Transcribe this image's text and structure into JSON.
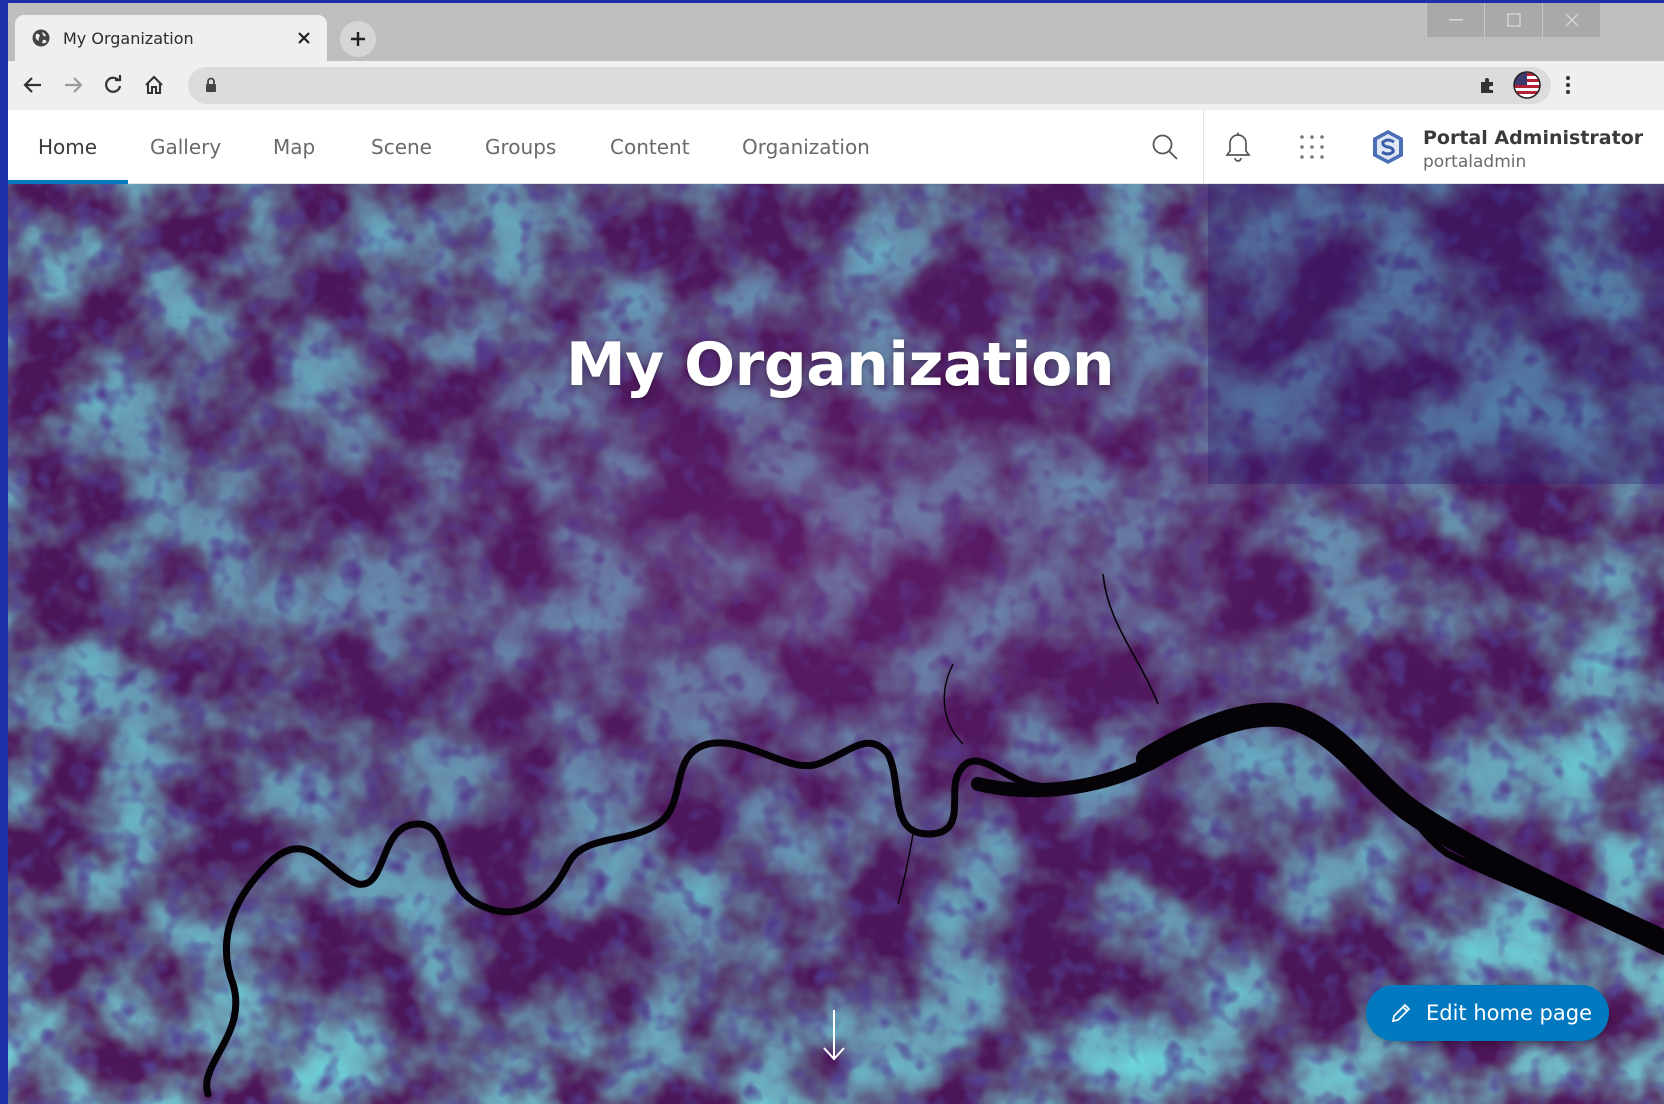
{
  "browser": {
    "tab_title": "My Organization",
    "url": "",
    "icons": {
      "favicon": "globe-icon",
      "close": "close-icon",
      "new_tab": "plus-icon",
      "back": "back-arrow-icon",
      "forward": "forward-arrow-icon",
      "reload": "reload-icon",
      "home": "home-icon",
      "lock": "lock-icon",
      "bookmark": "star-icon",
      "extensions": "puzzle-icon",
      "profile": "flag-avatar-icon",
      "menu": "kebab-menu-icon"
    }
  },
  "portal_nav": {
    "items": [
      {
        "label": "Home",
        "active": true
      },
      {
        "label": "Gallery",
        "active": false
      },
      {
        "label": "Map",
        "active": false
      },
      {
        "label": "Scene",
        "active": false
      },
      {
        "label": "Groups",
        "active": false
      },
      {
        "label": "Content",
        "active": false
      },
      {
        "label": "Organization",
        "active": false
      }
    ],
    "icons": [
      "search-icon",
      "bell-icon",
      "app-launcher-icon"
    ],
    "user": {
      "full_name": "Portal Administrator",
      "username": "portaladmin"
    }
  },
  "hero": {
    "title": "My Organization",
    "edit_button_label": "Edit home page"
  },
  "colors": {
    "accent": "#0079c1",
    "map_purple": "#4a1458",
    "map_teal": "#2a8c7e",
    "map_indigo": "#2c1a6e"
  }
}
